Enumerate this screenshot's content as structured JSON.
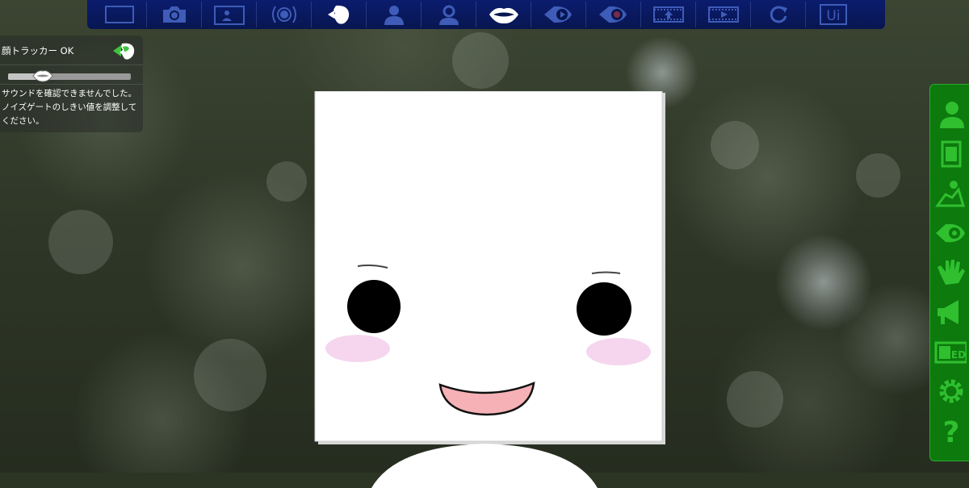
{
  "toolbar": {
    "buttons": [
      {
        "icon": "fullscreen-icon",
        "state": "inactive"
      },
      {
        "icon": "camera-icon",
        "state": "inactive"
      },
      {
        "icon": "background-image-icon",
        "state": "inactive"
      },
      {
        "icon": "broadcast-icon",
        "state": "inactive"
      },
      {
        "icon": "face-tracking-icon",
        "state": "active"
      },
      {
        "icon": "avatar-icon",
        "state": "inactive"
      },
      {
        "icon": "settings-gear-icon",
        "state": "inactive"
      },
      {
        "icon": "lip-sync-icon",
        "state": "active"
      },
      {
        "icon": "eye-play-icon",
        "state": "inactive"
      },
      {
        "icon": "eye-record-icon",
        "state": "inactive"
      },
      {
        "icon": "film-upload-icon",
        "state": "inactive"
      },
      {
        "icon": "film-play-icon",
        "state": "inactive"
      },
      {
        "icon": "reset-rotate-icon",
        "state": "inactive"
      },
      {
        "icon": "ui-toggle-icon",
        "state": "inactive",
        "label": "Ui"
      }
    ],
    "colors": {
      "background": "#0b1c6e",
      "inactive_icon": "#3e5cb8",
      "active_icon": "#ffffff"
    }
  },
  "status": {
    "face_tracker_label": "顔トラッカー OK",
    "noise_gate_level": 0.28,
    "sound_message": "サウンドを確認できませんでした。ノイズゲートのしきい値を調整してください。"
  },
  "side_panel": {
    "buttons": [
      {
        "icon": "person-icon"
      },
      {
        "icon": "body-frame-icon"
      },
      {
        "icon": "pose-icon"
      },
      {
        "icon": "eye-settings-icon"
      },
      {
        "icon": "hand-icon"
      },
      {
        "icon": "megaphone-icon"
      },
      {
        "icon": "edit-screen-icon",
        "label": "ED"
      },
      {
        "icon": "gear-icon"
      },
      {
        "icon": "help-icon",
        "label": "?"
      }
    ],
    "colors": {
      "background": "#0d7a0d",
      "icon": "#2fbf2f"
    }
  }
}
